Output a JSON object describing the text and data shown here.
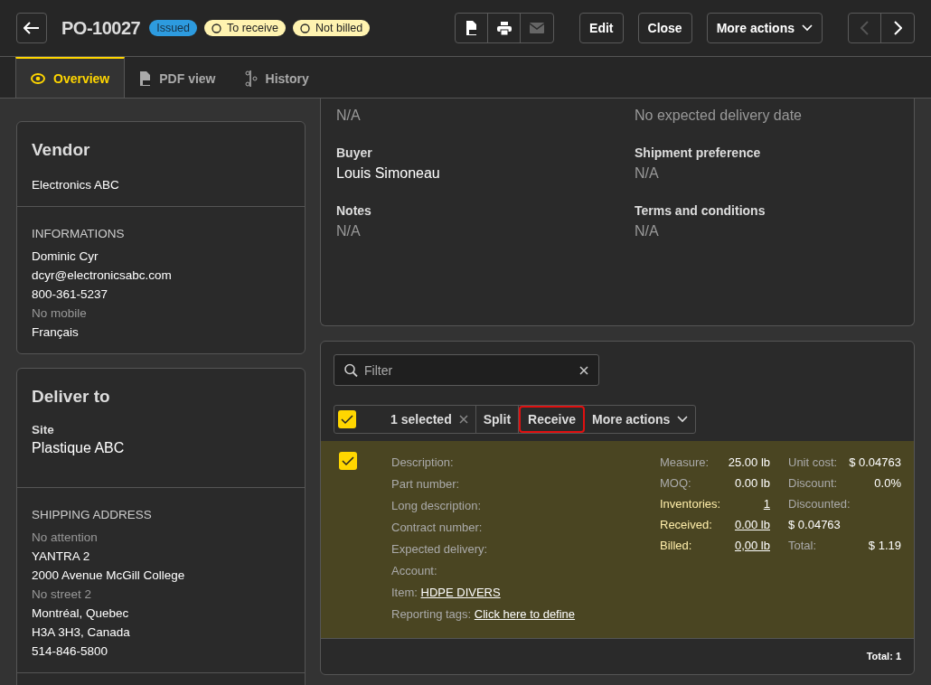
{
  "header": {
    "title": "PO-10027",
    "badges": [
      {
        "label": "Issued",
        "kind": "status"
      },
      {
        "label": "To receive",
        "kind": "pending"
      },
      {
        "label": "Not billed",
        "kind": "pending"
      }
    ],
    "icon_buttons": [
      {
        "kind": "pdf",
        "disabled": false
      },
      {
        "kind": "print",
        "disabled": false
      },
      {
        "kind": "email",
        "disabled": true
      }
    ],
    "buttons": [
      "Edit",
      "Close"
    ],
    "more_actions": "More actions",
    "nav": [
      {
        "kind": "prev",
        "disabled": true
      },
      {
        "kind": "next",
        "disabled": false
      }
    ]
  },
  "tabs": [
    {
      "label": "Overview",
      "kind": "eye",
      "selected": true
    },
    {
      "label": "PDF view",
      "kind": "pdf",
      "selected": false
    },
    {
      "label": "History",
      "kind": "history",
      "selected": false
    }
  ],
  "vendor": {
    "title": "Vendor",
    "name": "Electronics ABC",
    "section": "INFORMATIONS",
    "lines": [
      {
        "text": "Dominic Cyr",
        "muted": false
      },
      {
        "text": "dcyr@electronicsabc.com",
        "muted": false
      },
      {
        "text": "800-361-5237",
        "muted": false
      },
      {
        "text": "No mobile",
        "muted": true
      },
      {
        "text": "Français",
        "muted": false
      }
    ]
  },
  "deliver_to": {
    "title": "Deliver to",
    "site_label": "Site",
    "site": "Plastique ABC",
    "section": "SHIPPING ADDRESS",
    "lines": [
      {
        "text": "No attention",
        "muted": true
      },
      {
        "text": "YANTRA 2",
        "muted": false
      },
      {
        "text": "2000 Avenue McGill College",
        "muted": false
      },
      {
        "text": "No street 2",
        "muted": true
      },
      {
        "text": "Montréal, Quebec",
        "muted": false
      },
      {
        "text": "H3A 3H3, Canada",
        "muted": false
      },
      {
        "text": "514-846-5800",
        "muted": false
      }
    ]
  },
  "details": {
    "fields": [
      {
        "value": "N/A",
        "muted": true
      },
      {
        "value": "No expected delivery date",
        "muted": true
      },
      {
        "label": "Buyer",
        "value": "Louis Simoneau",
        "muted": false
      },
      {
        "label": "Shipment preference",
        "value": "N/A",
        "muted": true
      },
      {
        "label": "Notes",
        "value": "N/A",
        "muted": true
      },
      {
        "label": "Terms and conditions",
        "value": "N/A",
        "muted": true
      }
    ]
  },
  "lines_panel": {
    "filter": {
      "placeholder": "Filter"
    },
    "selection": {
      "checked": true,
      "count": "1 selected"
    },
    "actions": [
      {
        "label": "Split",
        "highlighted": false
      },
      {
        "label": "Receive",
        "highlighted": true
      }
    ],
    "more_actions": "More actions",
    "items": [
      {
        "selected": true,
        "left": [
          {
            "label": "Description:"
          },
          {
            "label": "Part number:"
          },
          {
            "label": "Long description:"
          },
          {
            "label": "Contract number:"
          },
          {
            "label": "Expected delivery:"
          },
          {
            "label": "Account:"
          },
          {
            "label": "Item:",
            "link": "HDPE DIVERS"
          },
          {
            "label": "Reporting tags:",
            "link": "Click here to define"
          }
        ],
        "middle": [
          {
            "label": "Measure:",
            "value": "25.00 lb",
            "link": false
          },
          {
            "label": "MOQ:",
            "value": "0.00 lb",
            "link": false
          },
          {
            "label": "Inventories:",
            "value": "1",
            "link": true
          },
          {
            "label": "Received:",
            "value": "0.00 lb",
            "link": true
          },
          {
            "label": "Billed:",
            "value": "0,00 lb",
            "link": true
          }
        ],
        "right": [
          {
            "label": "Unit cost:",
            "value": "$ 0.04763",
            "kind": "inline"
          },
          {
            "label": "Discount:",
            "value": "0.0%",
            "kind": "inline"
          },
          {
            "label": "Discounted:",
            "value": "$ 0.04763",
            "kind": "stacked"
          },
          {
            "label": "Total:",
            "value": "$ 1.19",
            "kind": "inline"
          }
        ]
      }
    ],
    "footer": "Total: 1"
  }
}
